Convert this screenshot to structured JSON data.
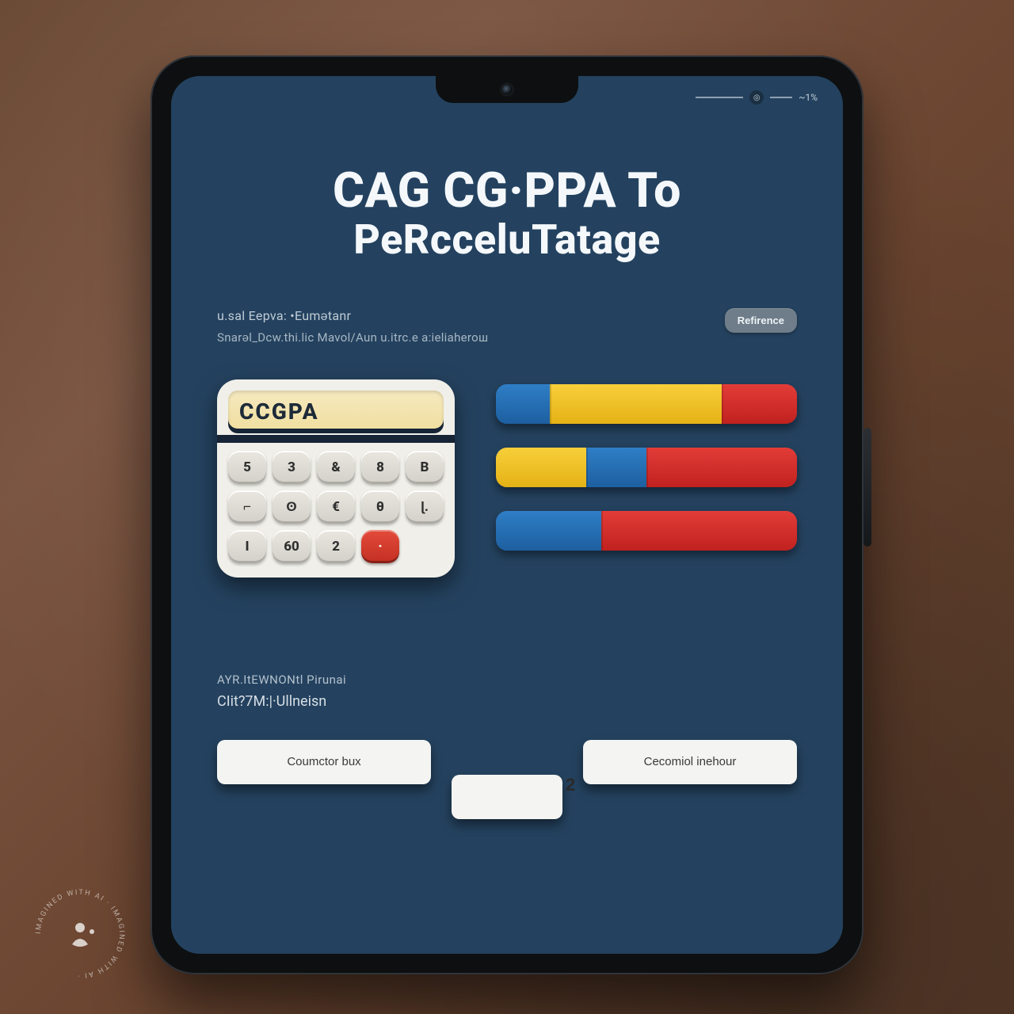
{
  "status": {
    "icon_glyph": "◎",
    "tail_text": "~1%"
  },
  "title": {
    "line1": "CAG CG·PPA To",
    "line2": "PeRcceluTatage"
  },
  "subtitle": {
    "line_a": "u.sal Eepva: •Eumǝtanr",
    "line_b": "Snarǝl_Dcw.thi.lic  Mavol/Aun  u.itrc.e  a:ieliaheroш"
  },
  "side_button_label": "Refirence",
  "calculator": {
    "display": "CCGPA",
    "keys": [
      {
        "t": "5",
        "red": false
      },
      {
        "t": "3",
        "red": false
      },
      {
        "t": "&",
        "red": false
      },
      {
        "t": "8",
        "red": false
      },
      {
        "t": "B",
        "red": false
      },
      {
        "t": "⌐",
        "red": false
      },
      {
        "t": "ʘ",
        "red": false
      },
      {
        "t": "€",
        "red": false
      },
      {
        "t": "θ",
        "red": false
      },
      {
        "t": "ɭ.",
        "red": false
      },
      {
        "t": "I",
        "red": false
      },
      {
        "t": "60",
        "red": false
      },
      {
        "t": "2",
        "red": false
      },
      {
        "t": "·",
        "red": true
      },
      {
        "t": "",
        "red": false
      }
    ]
  },
  "chart_data": {
    "type": "bar",
    "orientation": "horizontal-stacked",
    "series_colors": {
      "blue": "#2f7ec6",
      "yellow": "#f8cf3a",
      "red": "#e23c38"
    },
    "rows": [
      {
        "segments": [
          {
            "color": "blue",
            "pct": 18
          },
          {
            "color": "yellow",
            "pct": 57
          },
          {
            "color": "red",
            "pct": 25
          }
        ]
      },
      {
        "segments": [
          {
            "color": "yellow",
            "pct": 30
          },
          {
            "color": "blue",
            "pct": 20
          },
          {
            "color": "red",
            "pct": 50
          }
        ]
      },
      {
        "segments": [
          {
            "color": "blue",
            "pct": 35
          },
          {
            "color": "red",
            "pct": 65
          }
        ]
      }
    ]
  },
  "footer_text": {
    "line_a": "AYR.ItEWNONtl Pirunai",
    "line_b": "CIit?7M:|·Ullneisn"
  },
  "buttons": {
    "left": "Coumctor bux",
    "middle": "2",
    "right": "Cecomiol inehour"
  },
  "watermark": "IMAGINED WITH AI · IMAGINED WITH AI ·"
}
